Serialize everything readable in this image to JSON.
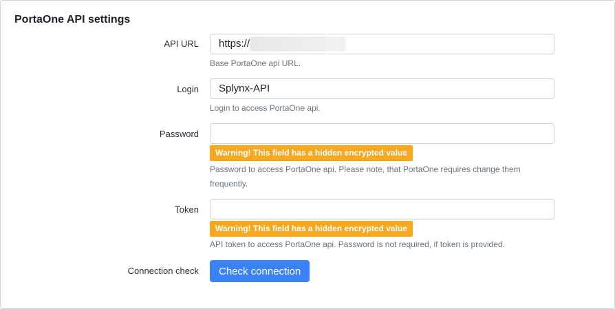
{
  "title": "PortaOne API settings",
  "fields": {
    "api_url": {
      "label": "API URL",
      "value": "https://",
      "help": "Base PortaOne api URL."
    },
    "login": {
      "label": "Login",
      "value": "Splynx-API",
      "help": "Login to access PortaOne api."
    },
    "password": {
      "label": "Password",
      "value": "",
      "warning": "Warning! This field has a hidden encrypted value",
      "help_line1": "Password to access PortaOne api. Please note, that PortaOne requires change them",
      "help_line2": "frequently."
    },
    "token": {
      "label": "Token",
      "value": "",
      "warning": "Warning! This field has a hidden encrypted value",
      "help": "API token to access PortaOne api. Password is not required, if token is provided."
    },
    "connection": {
      "label": "Connection check",
      "button": "Check connection"
    }
  },
  "colors": {
    "warning_bg": "#f6a821",
    "primary_button": "#3b82f6"
  }
}
